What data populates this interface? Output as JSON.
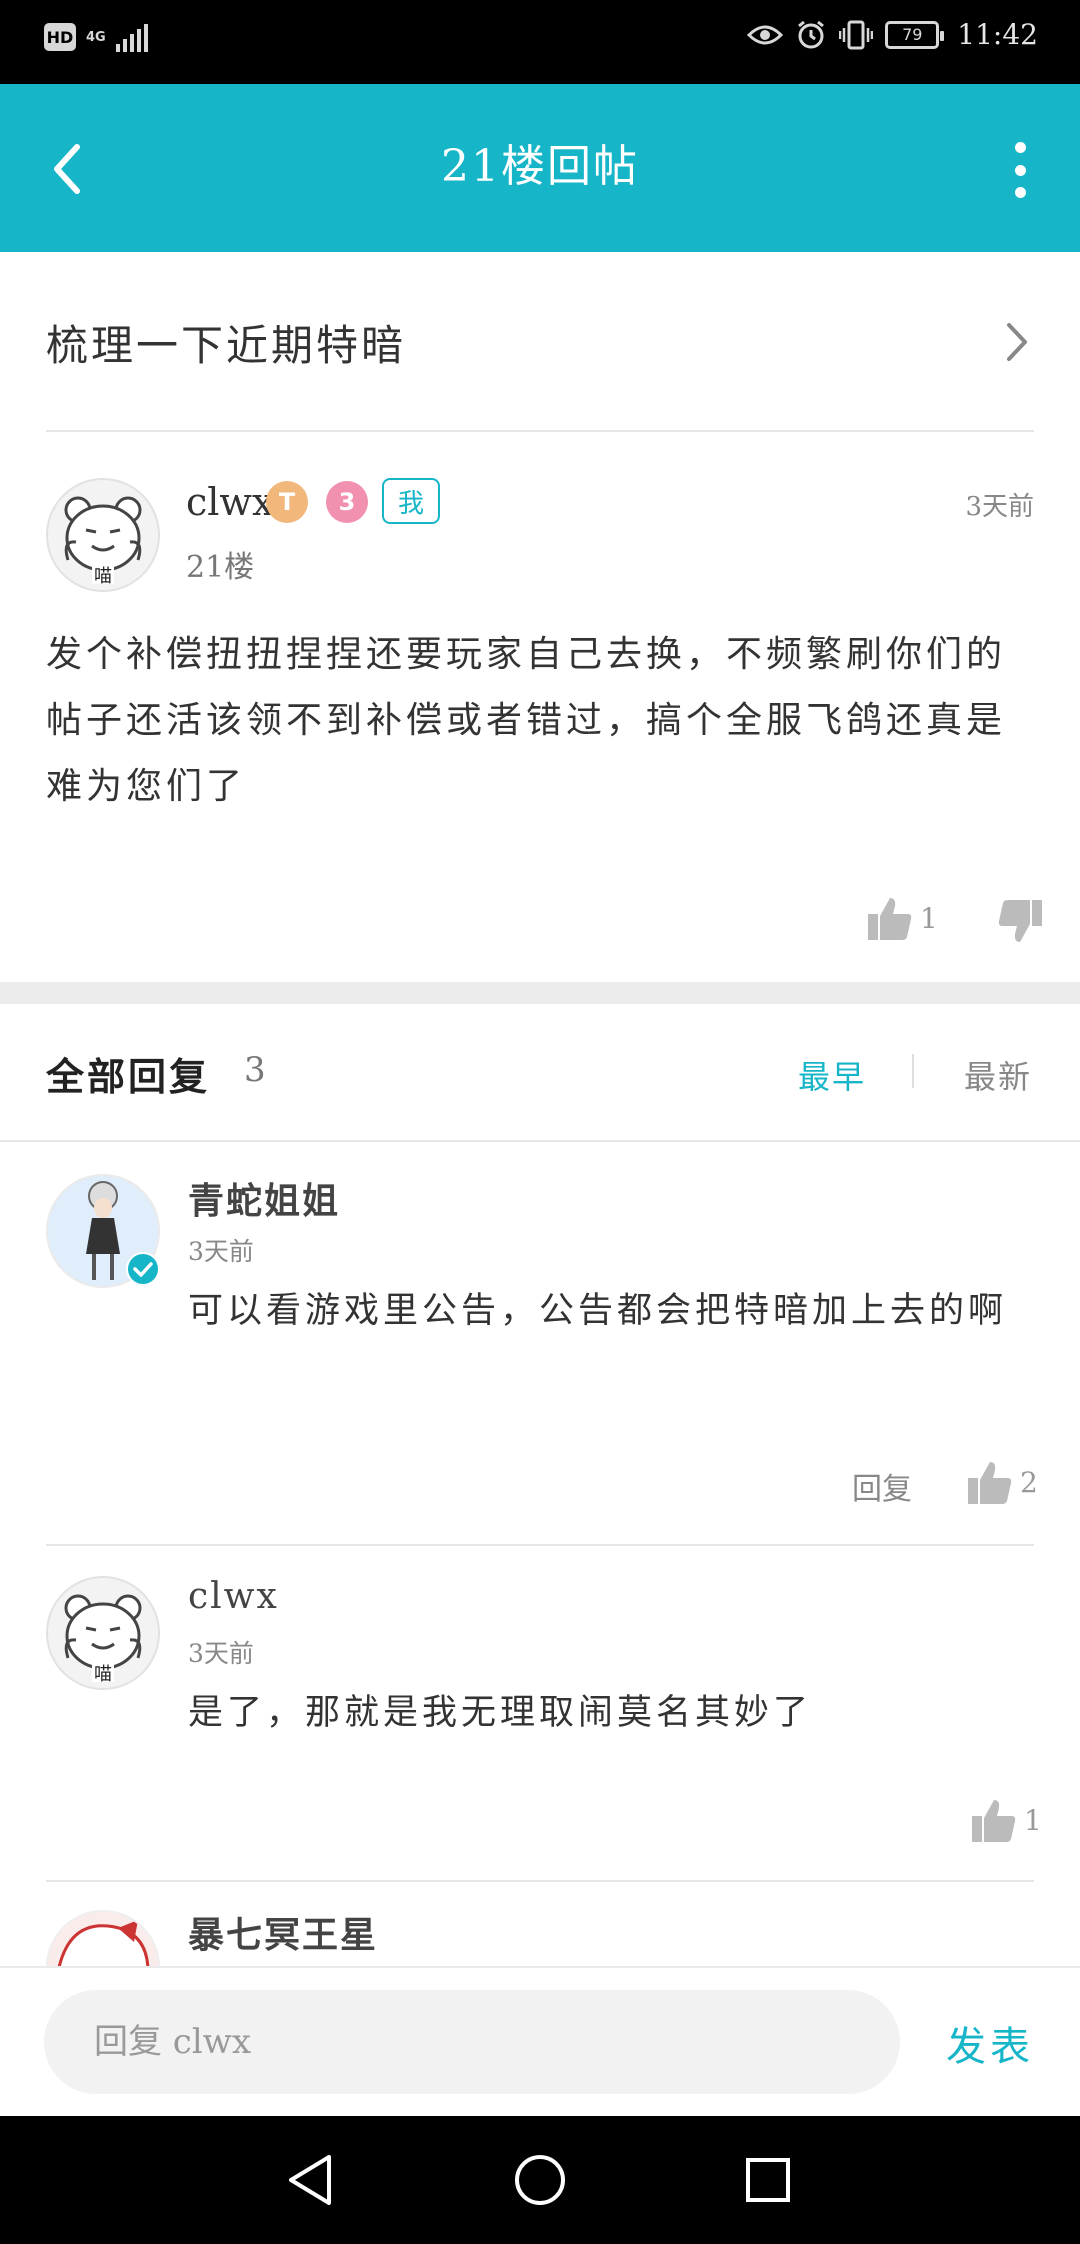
{
  "status_bar": {
    "hd": "HD",
    "network": "4G",
    "battery": "79",
    "time": "11:42"
  },
  "header": {
    "title": "21楼回帖"
  },
  "thread": {
    "title": "梳理一下近期特暗"
  },
  "post": {
    "author": "clwx",
    "level_badge": "T",
    "me_tag": "我",
    "floor": "21楼",
    "time": "3天前",
    "content": "发个补偿扭扭捏捏还要玩家自己去换，不频繁刷你们的帖子还活该领不到补偿或者错过，搞个全服飞鸽还真是难为您们了",
    "likes": "1"
  },
  "replies_header": {
    "title": "全部回复",
    "count": "3",
    "sort_earliest": "最早",
    "sort_newest": "最新"
  },
  "replies": [
    {
      "author": "青蛇姐姐",
      "time": "3天前",
      "content": "可以看游戏里公告，公告都会把特暗加上去的啊",
      "reply_label": "回复",
      "likes": "2"
    },
    {
      "author": "clwx",
      "time": "3天前",
      "content": "是了，那就是我无理取闹莫名其妙了",
      "likes": "1"
    },
    {
      "author": "暴七冥王星"
    }
  ],
  "reply_bar": {
    "placeholder": "回复 clwx",
    "send_label": "发表"
  },
  "colors": {
    "accent": "#16b6c8"
  }
}
